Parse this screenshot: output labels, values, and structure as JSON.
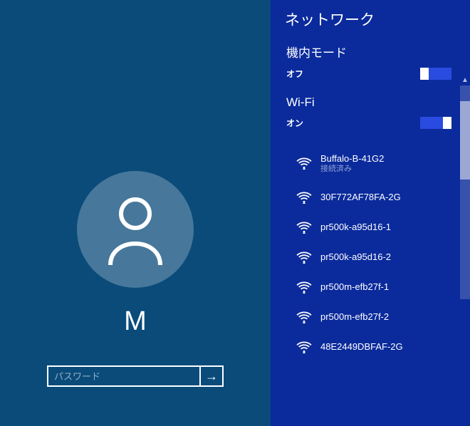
{
  "login": {
    "username": "M",
    "password_placeholder": "パスワード"
  },
  "network": {
    "title": "ネットワーク",
    "airplane": {
      "heading": "機内モード",
      "state_label": "オフ",
      "on": false
    },
    "wifi": {
      "heading": "Wi-Fi",
      "state_label": "オン",
      "on": true,
      "items": [
        {
          "name": "Buffalo-B-41G2",
          "status": "接続済み"
        },
        {
          "name": "30F772AF78FA-2G",
          "status": ""
        },
        {
          "name": "pr500k-a95d16-1",
          "status": ""
        },
        {
          "name": "pr500k-a95d16-2",
          "status": ""
        },
        {
          "name": "pr500m-efb27f-1",
          "status": ""
        },
        {
          "name": "pr500m-efb27f-2",
          "status": ""
        },
        {
          "name": "48E2449DBFAF-2G",
          "status": ""
        }
      ]
    }
  }
}
